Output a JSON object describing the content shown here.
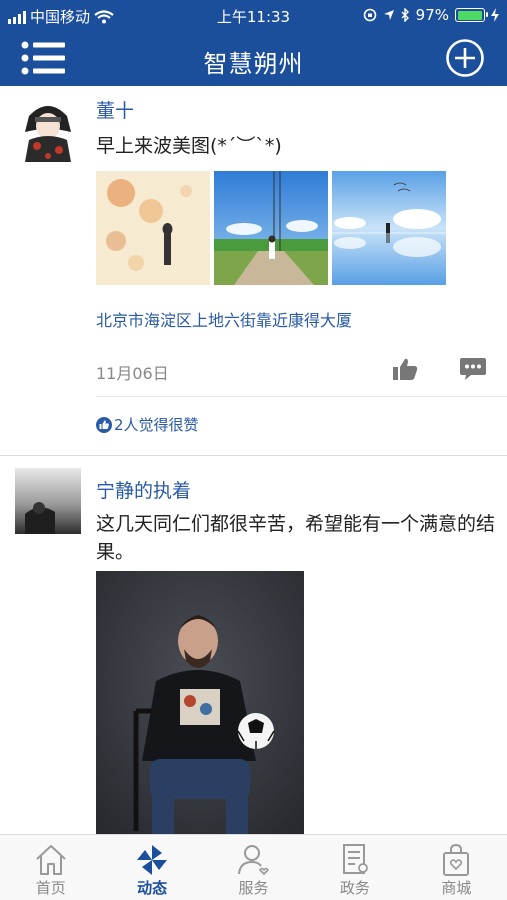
{
  "status": {
    "carrier": "中国移动",
    "time": "上午11:33",
    "battery": "97%",
    "battery_level": 0.97
  },
  "header": {
    "title": "智慧朔州"
  },
  "posts": [
    {
      "username": "董十",
      "text": "早上来波美图(*´︶`*)",
      "location": "北京市海淀区上地六街靠近康得大厦",
      "date": "11月06日",
      "likes": "2人觉得很赞"
    },
    {
      "username": "宁静的执着",
      "text": "这几天同仁们都很辛苦，希望能有一个满意的结果。"
    }
  ],
  "tabs": [
    {
      "label": "首页",
      "icon": "home-icon"
    },
    {
      "label": "动态",
      "icon": "pinwheel-icon"
    },
    {
      "label": "服务",
      "icon": "person-service-icon"
    },
    {
      "label": "政务",
      "icon": "document-icon"
    },
    {
      "label": "商城",
      "icon": "shopping-bag-icon"
    }
  ],
  "colors": {
    "brand": "#1b4f9c",
    "link": "#2a5aa7"
  }
}
